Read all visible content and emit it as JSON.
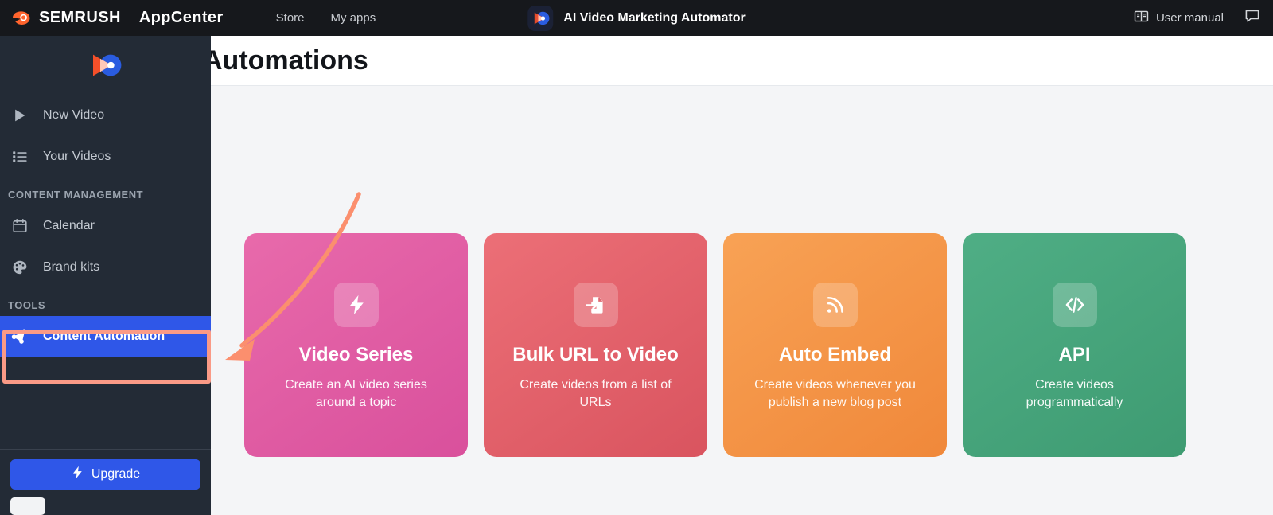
{
  "topbar": {
    "brand_name": "SEMRUSH",
    "brand_sub": "AppCenter",
    "nav": [
      {
        "label": "Store",
        "name": "store"
      },
      {
        "label": "My apps",
        "name": "my-apps"
      }
    ],
    "app_title": "AI Video Marketing Automator",
    "user_manual_label": "User manual",
    "icons": {
      "book": "book-icon",
      "chat": "chat-bubble-icon",
      "app": "app-logo-icon"
    }
  },
  "sidebar": {
    "logo": "video-automator-logo",
    "items": [
      {
        "label": "New Video",
        "icon": "play-icon",
        "name": "new-video",
        "active": false
      },
      {
        "label": "Your Videos",
        "icon": "list-icon",
        "name": "your-videos",
        "active": false
      }
    ],
    "sections": [
      {
        "label": "CONTENT MANAGEMENT",
        "items": [
          {
            "label": "Calendar",
            "icon": "calendar-icon",
            "name": "calendar",
            "active": false
          },
          {
            "label": "Brand kits",
            "icon": "palette-icon",
            "name": "brand-kits",
            "active": false
          }
        ]
      },
      {
        "label": "TOOLS",
        "items": [
          {
            "label": "Content Automation",
            "icon": "share-nodes-icon",
            "name": "content-automation",
            "active": true
          }
        ]
      }
    ],
    "upgrade": {
      "label": "Upgrade",
      "icon": "lightning-bolt-icon"
    }
  },
  "page": {
    "title": "Automations"
  },
  "cards": [
    {
      "title": "Video Series",
      "desc": "Create an AI video series around a topic",
      "icon": "lightning-bolt-icon",
      "name": "video-series",
      "color_from": "#e86aab",
      "color_to": "#d94f9c"
    },
    {
      "title": "Bulk URL to Video",
      "desc": "Create videos from a list of URLs",
      "icon": "file-import-icon",
      "name": "bulk-url-to-video",
      "color_from": "#ec6f77",
      "color_to": "#d9555f"
    },
    {
      "title": "Auto Embed",
      "desc": "Create videos whenever you publish a new blog post",
      "icon": "rss-icon",
      "name": "auto-embed",
      "color_from": "#f8a255",
      "color_to": "#f08b3d"
    },
    {
      "title": "API",
      "desc": "Create videos programmatically",
      "icon": "code-icon",
      "name": "api",
      "color_from": "#4fae85",
      "color_to": "#3f9c73"
    }
  ],
  "annotations": {
    "highlight_color": "#fa9a86",
    "arrow_color": "#fb8f6e",
    "highlight_target": "content-automation",
    "arrow_target": "video-series"
  },
  "colors": {
    "accent_blue": "#2f57e8",
    "sidebar_bg": "#232b36",
    "topbar_bg": "#16181c",
    "content_bg": "#f4f5f7"
  }
}
